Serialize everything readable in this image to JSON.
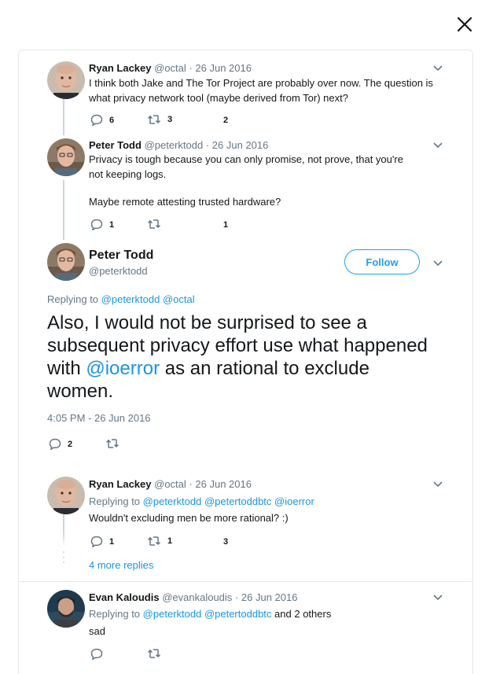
{
  "close_label": "close",
  "tweets": {
    "t1": {
      "name": "Ryan Lackey",
      "handle": "@octal",
      "sep": "·",
      "date": "26 Jun 2016",
      "text": "I think both Jake and The Tor Project are probably over now. The question is what privacy network tool (maybe derived from Tor) next?",
      "replies": "6",
      "retweets": "3",
      "likes": "2"
    },
    "t2": {
      "name": "Peter Todd",
      "handle": "@peterktodd",
      "sep": "·",
      "date": "26 Jun 2016",
      "text_1": "Privacy is tough because you can only promise, not prove, that you're not keeping logs.",
      "text_2": "Maybe remote attesting trusted hardware?",
      "replies": "1",
      "likes": "1"
    },
    "main": {
      "name": "Peter Todd",
      "handle": "@peterktodd",
      "follow_label": "Follow",
      "replying_prefix": "Replying to",
      "replying_to_1": "@peterktodd",
      "replying_to_2": "@octal",
      "text_before": "Also, I would not be surprised to see a subsequent privacy effort use what happened with ",
      "mention": "@ioerror",
      "text_after": " as an rational to exclude women.",
      "timestamp": "4:05 PM - 26 Jun 2016",
      "replies": "2"
    },
    "t3": {
      "name": "Ryan Lackey",
      "handle": "@octal",
      "sep": "·",
      "date": "26 Jun 2016",
      "replying_prefix": "Replying to",
      "replying_to_1": "@peterktodd",
      "replying_to_2": "@petertoddbtc",
      "replying_to_3": "@ioerror",
      "text": "Wouldn't excluding men be more rational? :)",
      "replies": "1",
      "retweets": "1",
      "likes": "3",
      "more_replies": "4 more replies"
    },
    "t4": {
      "name": "Evan Kaloudis",
      "handle": "@evankaloudis",
      "sep": "·",
      "date": "26 Jun 2016",
      "replying_prefix": "Replying to",
      "replying_to_1": "@peterktodd",
      "replying_to_2": "@petertoddbtc",
      "replying_suffix": "and 2 others",
      "text": "sad"
    }
  },
  "colors": {
    "link": "#1b95e0",
    "follow": "#1da1f2",
    "muted": "#657786",
    "line": "#ccd6dd"
  }
}
